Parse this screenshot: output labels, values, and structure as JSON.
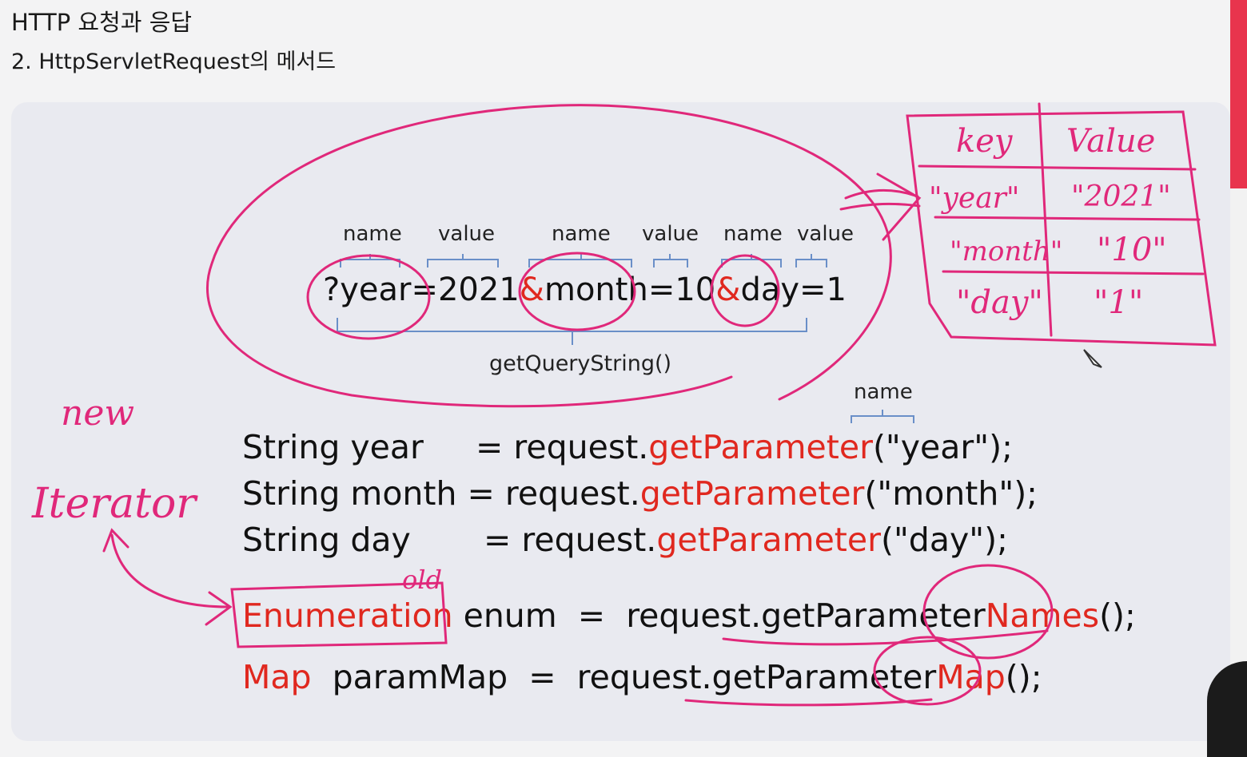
{
  "header": {
    "title": "HTTP 요청과 응답",
    "subtitle": "2. HttpServletRequest의 메서드"
  },
  "query": {
    "labels": [
      "name",
      "value",
      "name",
      "value",
      "name",
      "value"
    ],
    "q": "?year=",
    "v1": "2021",
    "amp": "&",
    "month": "month",
    "eq": "=",
    "v2": "10",
    "day": "day",
    "v3": "1",
    "method": "getQueryString()"
  },
  "param_label": "name",
  "code": {
    "l1_pre": "String year     = request.",
    "l1_fn": "getParameter",
    "l1_post": "(\"year\");",
    "l2_pre": "String month = request.",
    "l2_fn": "getParameter",
    "l2_post": "(\"month\");",
    "l3_pre": "String day       = request.",
    "l3_fn": "getParameter",
    "l3_post": "(\"day\");",
    "l4_type": "Enumeration",
    "l4_mid": " enum  =  request.getParameter",
    "l4_fn": "Names",
    "l4_post": "();",
    "l5_type": "Map",
    "l5_mid": "  paramMap  =  request.getParameter",
    "l5_fn": "Map",
    "l5_post": "();"
  },
  "annotations": {
    "new": "new",
    "iterator": "Iterator",
    "old": "old",
    "table_key": "key",
    "table_value": "Value",
    "rows": [
      {
        "key": "\"year\"",
        "value": "\"2021\""
      },
      {
        "key": "\"month\"",
        "value": "\"10\""
      },
      {
        "key": "\"day\"",
        "value": "\"1\""
      }
    ]
  },
  "colors": {
    "ink": "#e0287a",
    "accent_red": "#e0281f",
    "bracket": "#6a8fc8"
  }
}
